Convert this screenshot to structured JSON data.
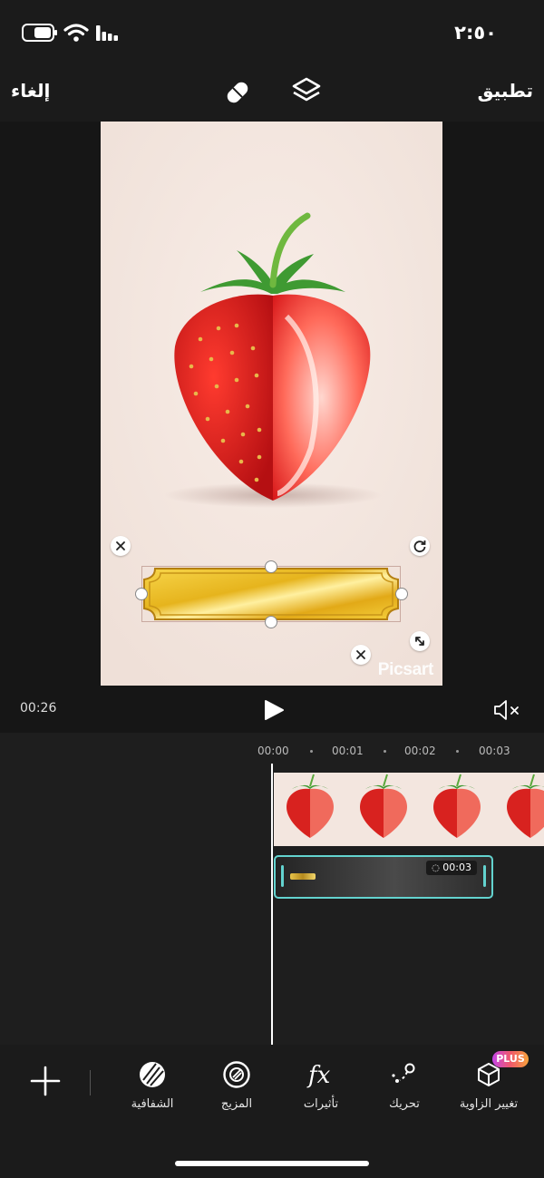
{
  "status_bar": {
    "time": "٢:٥٠"
  },
  "top_bar": {
    "cancel_label": "إلغاء",
    "apply_label": "تطبيق"
  },
  "preview": {
    "watermark": "Picsart",
    "current_time": "00:26"
  },
  "timeline": {
    "ruler": [
      "00:00",
      "00:01",
      "00:02",
      "00:03"
    ],
    "overlay_duration": "00:03"
  },
  "toolbar": {
    "tools": [
      {
        "label": "الشفافية",
        "icon": "opacity-icon"
      },
      {
        "label": "المزيج",
        "icon": "blend-icon"
      },
      {
        "label": "تأثيرات",
        "icon": "fx-icon"
      },
      {
        "label": "تحريك",
        "icon": "animation-icon"
      },
      {
        "label": "تغيير الزاوية",
        "icon": "perspective-cube-icon",
        "badge": "PLUS"
      }
    ]
  }
}
